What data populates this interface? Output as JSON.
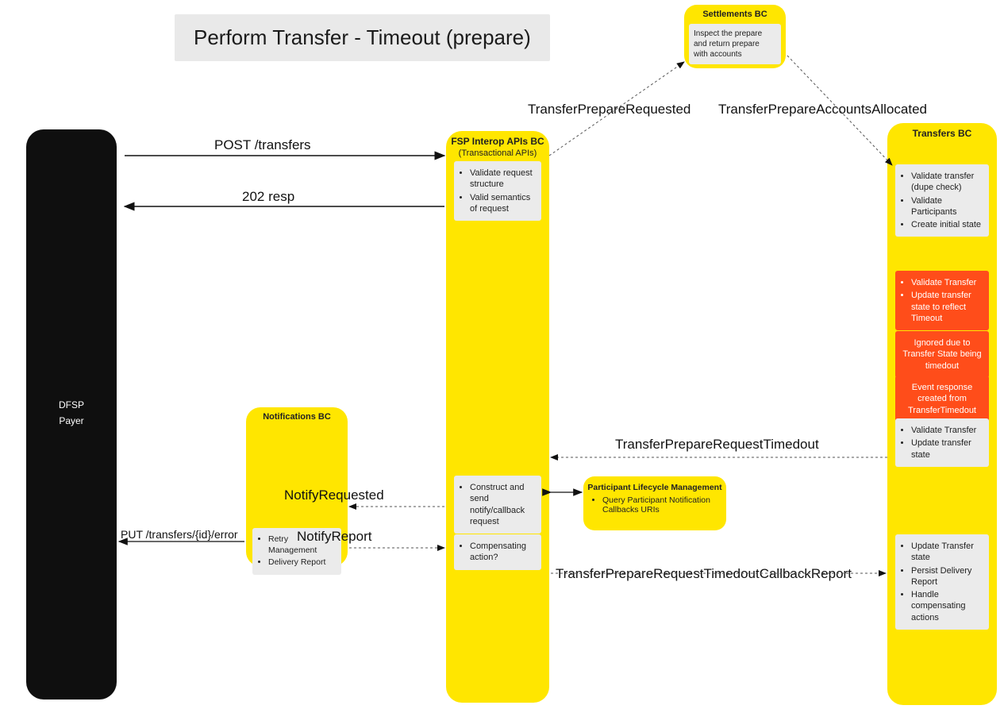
{
  "title": "Perform Transfer - Timeout (prepare)",
  "actors": {
    "dfsp": {
      "label1": "DFSP",
      "label2": "Payer"
    },
    "settlements": {
      "title": "Settlements BC",
      "note": "Inspect the prepare and return prepare with accounts"
    },
    "fsp": {
      "title": "FSP Interop APIs BC",
      "subtitle": "(Transactional APIs)",
      "n1a": "Validate request structure",
      "n1b": "Valid semantics of request",
      "n2": "Construct and send notify/callback request",
      "n3": "Compensating action?"
    },
    "participants": {
      "title": "Participant Lifecycle Management",
      "item": "Query Participant Notification Callbacks URIs"
    },
    "notifications": {
      "title": "Notifications BC",
      "a": "Retry Management",
      "b": "Delivery Report"
    },
    "transfers": {
      "title": "Transfers BC",
      "g1a": "Validate transfer (dupe check)",
      "g1b": "Validate Participants",
      "g1c": "Create initial state",
      "o1a": "Validate Transfer",
      "o1b": "Update transfer state to reflect Timeout",
      "o2": "Ignored due to Transfer State being timedout",
      "o3": "Event response created from TransferTimedout",
      "g2a": "Validate Transfer",
      "g2b": "Update transfer state",
      "g3a": "Update Transfer state",
      "g3b": "Persist Delivery Report",
      "g3c": "Handle compensating actions"
    }
  },
  "messages": {
    "post": "POST /transfers",
    "resp": "202 resp",
    "prepReq": "TransferPrepareRequested",
    "accAlloc": "TransferPrepareAccountsAllocated",
    "timedout": "TransferPrepareRequestTimedout",
    "notifyReq": "NotifyRequested",
    "notifyRep": "NotifyReport",
    "putErr": "PUT /transfers/{id}/error",
    "cbReport": "TransferPrepareRequestTimedoutCallbackReport"
  }
}
